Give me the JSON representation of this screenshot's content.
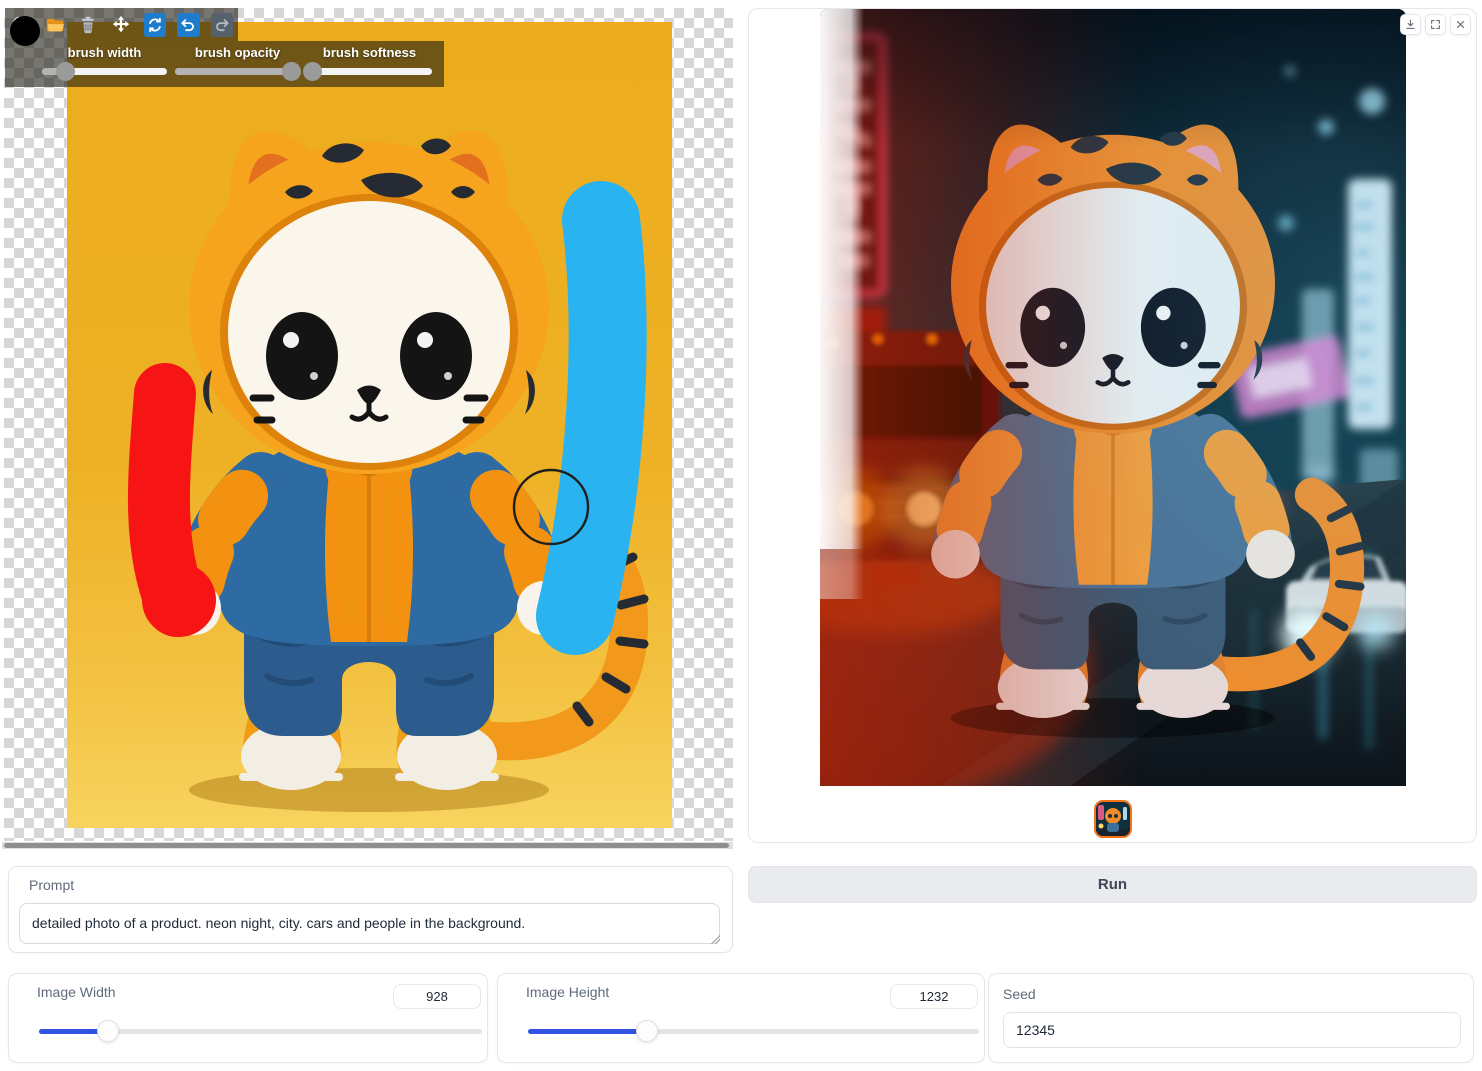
{
  "editor": {
    "tools": [
      "expand",
      "open-folder",
      "clear",
      "move",
      "sync",
      "undo",
      "redo"
    ],
    "brush": {
      "color": "#000000",
      "width_label": "brush width",
      "opacity_label": "brush opacity",
      "softness_label": "brush softness",
      "width_pct": 18,
      "opacity_pct": 93,
      "softness_pct": 4
    },
    "strokes": {
      "red": "#f71414",
      "blue": "#29b3f0"
    },
    "canvas": {
      "background_top": "#ecac1d",
      "background_bottom": "#f7d35e"
    }
  },
  "output": {
    "buttons": [
      "download",
      "fullscreen",
      "close"
    ],
    "accent": "#f97316"
  },
  "prompt": {
    "label": "Prompt",
    "value": "detailed photo of a product. neon night, city. cars and people in the background."
  },
  "run": {
    "label": "Run"
  },
  "controls": {
    "image_width": {
      "label": "Image Width",
      "value": "928",
      "slider_pct": 15.5
    },
    "image_height": {
      "label": "Image Height",
      "value": "1232",
      "slider_pct": 26.3
    },
    "seed": {
      "label": "Seed",
      "value": "12345"
    }
  }
}
